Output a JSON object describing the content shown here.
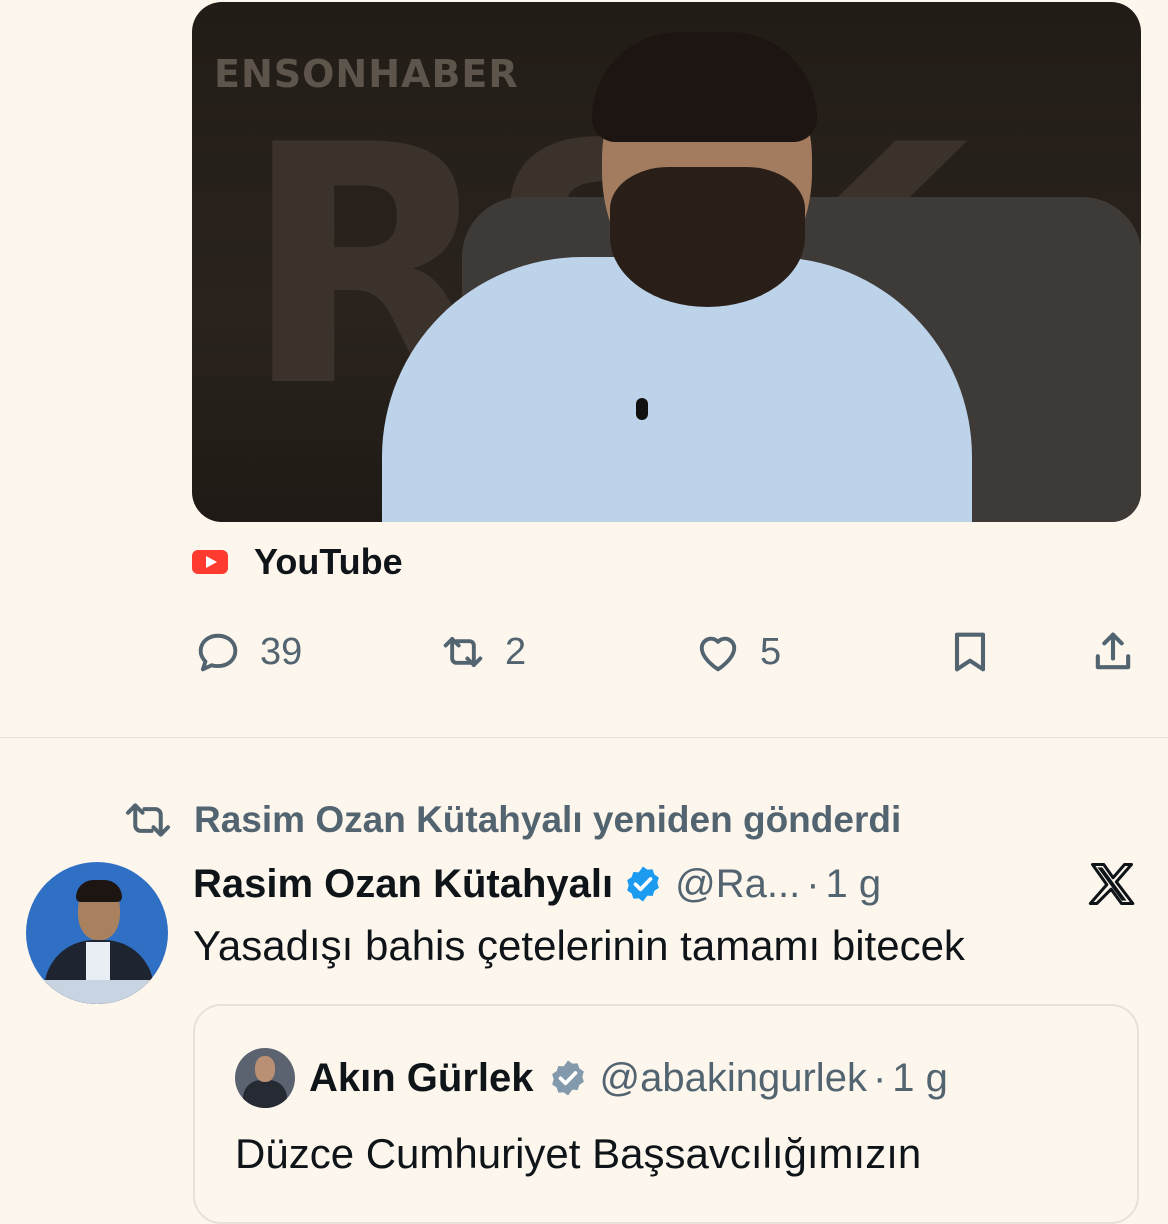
{
  "media": {
    "brand": "ENSONHABER",
    "overlay_letters": "RSK"
  },
  "link_card": {
    "source_label": "YouTube",
    "source_icon": "youtube-icon"
  },
  "actions": {
    "reply": {
      "icon": "reply-icon",
      "count": "39"
    },
    "repost": {
      "icon": "repost-icon",
      "count": "2"
    },
    "like": {
      "icon": "heart-icon",
      "count": "5"
    },
    "bookmark": {
      "icon": "bookmark-icon"
    },
    "share": {
      "icon": "share-icon"
    }
  },
  "tweet": {
    "repost_context": "Rasim Ozan Kütahyalı yeniden gönderdi",
    "author": {
      "display_name": "Rasim Ozan Kütahyalı",
      "handle": "@Ra...",
      "separator": "·",
      "time": "1 g"
    },
    "text": "Yasadışı bahis çetelerinin tamamı bitecek",
    "quote": {
      "display_name": "Akın Gürlek",
      "handle": "@abakingurlek",
      "separator": "·",
      "time": "1 g",
      "text": "Düzce Cumhuriyet Başsavcılığımızın"
    }
  },
  "colors": {
    "background": "#fcf6ed",
    "text_primary": "#0f1419",
    "text_secondary": "#536471",
    "verified_blue": "#1d9bf0",
    "verified_gray": "#829aab",
    "youtube_red": "#ff3b30"
  }
}
